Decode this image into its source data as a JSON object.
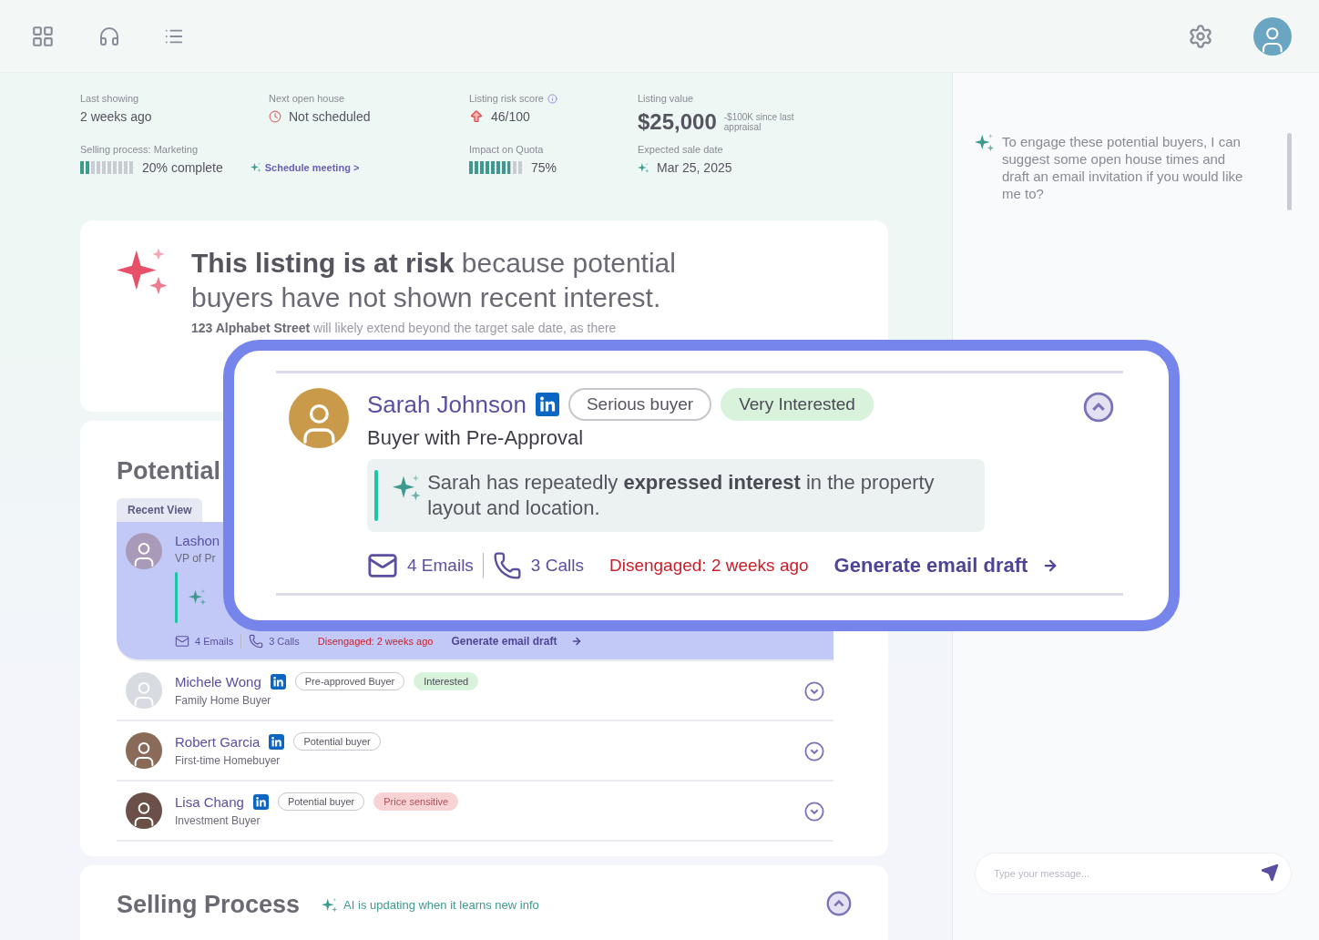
{
  "metrics": [
    {
      "kind": "text",
      "label": "Last showing",
      "value": "2 weeks ago"
    },
    {
      "kind": "alert",
      "label": "Next open house",
      "value": "Not scheduled"
    },
    {
      "kind": "risk",
      "label": "Listing risk score",
      "value": "46/100"
    },
    {
      "kind": "big",
      "label": "Listing value",
      "value": "$25,000",
      "note": "-$100K since last appraisal"
    },
    {
      "kind": "progress",
      "label": "Selling process: Marketing",
      "value": "20% complete",
      "level": 0.2,
      "link": "Schedule meeting >"
    },
    {
      "kind": "progress",
      "label": "Impact on Quota",
      "value": "75%",
      "level": 0.75
    },
    {
      "kind": "ai",
      "label": "Expected sale date",
      "value": "Mar 25, 2025"
    }
  ],
  "risk_card": {
    "headline": "**This listing is at risk** because potential buyers have not shown recent interest.",
    "body": "**123 Alphabet Street** will likely extend beyond the target sale date, as there"
  },
  "buyers_card": {
    "title": "Potential",
    "tabs": [
      {
        "label": "Recent View",
        "selected": true
      }
    ],
    "buyers": [
      {
        "name": "Lashon",
        "role": "VP of Pr",
        "highlighted": true,
        "expanded": true,
        "stats": {
          "emails": "4 Emails",
          "calls": "3 Calls",
          "status": "Disengaged: 2 weeks ago",
          "action": "Generate email draft"
        }
      },
      {
        "name": "Michele Wong",
        "role": "Family Home Buyer",
        "linkedin": true,
        "highlighted": false,
        "tags": [
          {
            "label": "Pre-approved Buyer",
            "kind": "outline"
          },
          {
            "label": "Interested",
            "kind": "positive"
          }
        ],
        "expanded": false
      },
      {
        "name": "Robert Garcia",
        "role": "First-time Homebuyer",
        "linkedin": true,
        "highlighted": false,
        "tags": [
          {
            "label": "Potential buyer",
            "kind": "outline"
          }
        ],
        "expanded": false
      },
      {
        "name": "Lisa Chang",
        "role": "Investment Buyer",
        "linkedin": true,
        "highlighted": false,
        "tags": [
          {
            "label": "Potential buyer",
            "kind": "outline"
          },
          {
            "label": "Price sensitive",
            "kind": "negative"
          }
        ],
        "expanded": false
      }
    ]
  },
  "selling_card": {
    "title": "Selling Process",
    "note": "AI is updating when it learns new info",
    "expanded": true
  },
  "chat": {
    "message": "To engage these potential buyers, I can suggest some open house times and draft an email invitation if you would like me to?",
    "placeholder": "Type your message..."
  },
  "callout": {
    "name": "Sarah Johnson",
    "role": "Buyer with Pre-Approval",
    "linkedin": true,
    "tags": [
      {
        "label": "Serious buyer",
        "kind": "outline"
      },
      {
        "label": "Very Interested",
        "kind": "positive"
      }
    ],
    "expanded": true,
    "insight": "Sarah has repeatedly **expressed interest** in the property layout and location.",
    "stats": {
      "emails": "4 Emails",
      "calls": "3 Calls",
      "status": "Disengaged: 2 weeks ago",
      "action": "Generate email draft"
    }
  }
}
